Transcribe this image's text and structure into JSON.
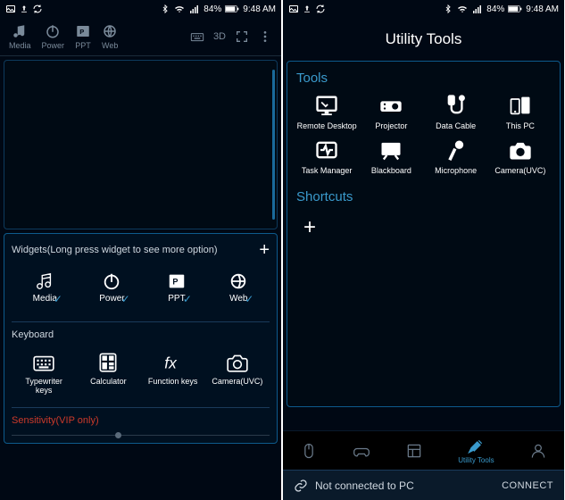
{
  "status": {
    "battery": "84%",
    "time": "9:48 AM"
  },
  "left": {
    "toolbar": [
      {
        "name": "media",
        "label": "Media"
      },
      {
        "name": "power",
        "label": "Power"
      },
      {
        "name": "ppt",
        "label": "PPT"
      },
      {
        "name": "web",
        "label": "Web"
      }
    ],
    "right_tools": {
      "threed": "3D"
    },
    "widgets": {
      "header": "Widgets(Long press widget to see more option)",
      "items": [
        {
          "name": "media",
          "label": "Media"
        },
        {
          "name": "power",
          "label": "Power"
        },
        {
          "name": "ppt",
          "label": "PPT"
        },
        {
          "name": "web",
          "label": "Web"
        }
      ]
    },
    "keyboard": {
      "label": "Keyboard",
      "items": [
        {
          "name": "typewriter",
          "label": "Typewriter keys"
        },
        {
          "name": "calculator",
          "label": "Calculator"
        },
        {
          "name": "function",
          "label": "Function keys"
        },
        {
          "name": "camera",
          "label": "Camera(UVC)"
        }
      ]
    },
    "sensitivity": "Sensitivity(VIP only)"
  },
  "right": {
    "title": "Utility Tools",
    "tools_label": "Tools",
    "tools": [
      {
        "name": "remote-desktop",
        "label": "Remote Desktop"
      },
      {
        "name": "projector",
        "label": "Projector"
      },
      {
        "name": "data-cable",
        "label": "Data Cable"
      },
      {
        "name": "this-pc",
        "label": "This PC"
      },
      {
        "name": "task-manager",
        "label": "Task Manager"
      },
      {
        "name": "blackboard",
        "label": "Blackboard"
      },
      {
        "name": "microphone",
        "label": "Microphone"
      },
      {
        "name": "camera-uvc",
        "label": "Camera(UVC)"
      }
    ],
    "shortcuts_label": "Shortcuts",
    "nav": {
      "active_label": "Utility Tools"
    },
    "connection": {
      "status": "Not connected to PC",
      "action": "CONNECT"
    }
  }
}
